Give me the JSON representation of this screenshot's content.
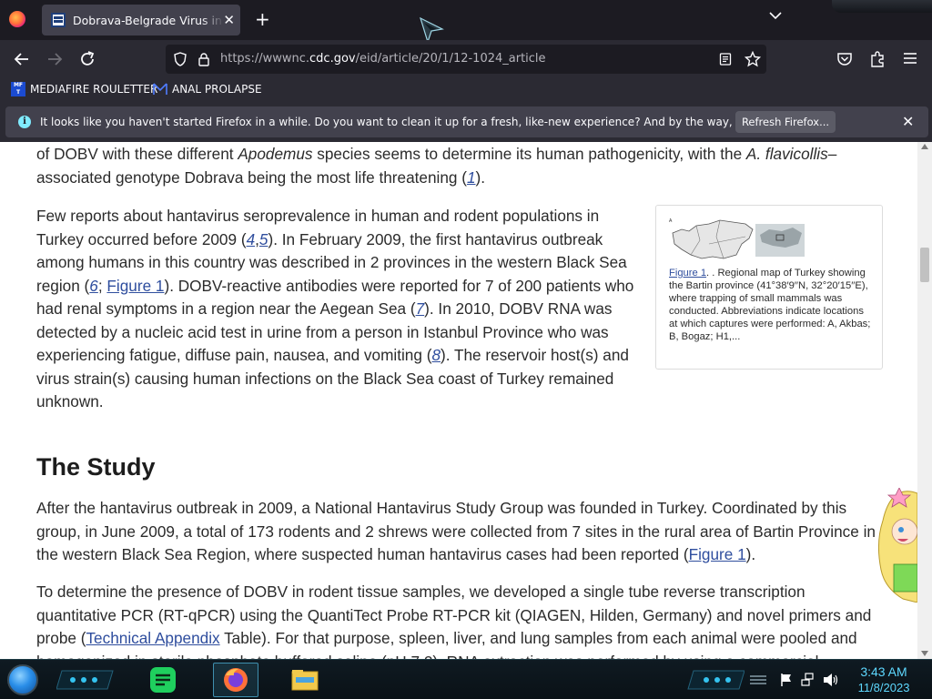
{
  "browser": {
    "tab": {
      "title": "Dobrava-Belgrade Virus in Apodemus"
    },
    "url": {
      "prefix": "https://wwwnc.",
      "domain": "cdc.gov",
      "path": "/eid/article/20/1/12-1024_article"
    },
    "bookmarks": [
      {
        "label": "MEDIAFIRE ROULETTER"
      },
      {
        "label": "ANAL PROLAPSE"
      }
    ],
    "notification": {
      "message": "It looks like you haven't started Firefox in a while. Do you want to clean it up for a fresh, like-new experience? And by the way, welcome back!",
      "button": "Refresh Firefox..."
    }
  },
  "article": {
    "p0": {
      "a": "of DOBV with these different ",
      "b": "Apodemus",
      "c": " species seems to determine its human pathogenicity, with the ",
      "d": "A. flavicollis",
      "e": "–associated genotype Dobrava being the most life threatening (",
      "ref1": "1",
      "f": ")."
    },
    "p1": {
      "a": "Few reports about hantavirus seroprevalence in human and rodent populations in Turkey occurred before 2009 (",
      "ref4": "4",
      "comma": ",",
      "ref5": "5",
      "b": "). In February 2009, the first hantavirus outbreak among humans in this country was described in 2 provinces in the western Black Sea region (",
      "ref6": "6",
      "semi": "; ",
      "fig": "Figure 1",
      "c": "). DOBV-reactive antibodies were reported for 7 of 200 patients who had renal symptoms in a region near the Aegean Sea (",
      "ref7": "7",
      "d": "). In 2010, DOBV RNA was detected by a nucleic acid test in urine from a person in Istanbul Province who was experiencing fatigue, diffuse pain, nausea, and vomiting (",
      "ref8": "8",
      "e": "). The reservoir host(s) and virus strain(s) causing human infections on the Black Sea coast of Turkey remained unknown."
    },
    "figure": {
      "link": "Figure 1",
      "caption": ". . Regional map of Turkey showing the Bartin province (41°38′9′′N, 32°20′15′′E), where trapping of small mammals was conducted. Abbreviations indicate locations at which captures were performed: A, Akbas; B, Bogaz; H1,..."
    },
    "heading": "The Study",
    "p2": {
      "a": "After the hantavirus outbreak in 2009, a National Hantavirus Study Group was founded in Turkey. Coordinated by this group, in June 2009, a total of 173 rodents and 2 shrews were collected from 7 sites in the rural area of Bartin Province in the western Black Sea Region, where suspected human hantavirus cases had been reported (",
      "fig": "Figure 1",
      "b": ")."
    },
    "p3": {
      "a": "To determine the presence of DOBV in rodent tissue samples, we developed a single tube reverse transcription quantitative PCR (RT-qPCR) using the QuantiTect Probe RT-PCR kit (QIAGEN, Hilden, Germany) and novel primers and probe (",
      "link": "Technical Appendix",
      "b": " Table). For that purpose, spleen, liver, and lung samples from each animal were pooled and homogenized in sterile phosphate buffered saline (pH 7.2). RNA extraction was performed by using a commercial"
    }
  },
  "taskbar": {
    "time": "3:43 AM",
    "date": "11/8/2023",
    "apps": [
      "start-orb-icon",
      "notes-app-icon",
      "firefox-icon",
      "file-explorer-icon"
    ]
  },
  "colors": {
    "link": "#2f4e9e",
    "clock": "#5ed8ff",
    "info": "#80ebff"
  }
}
